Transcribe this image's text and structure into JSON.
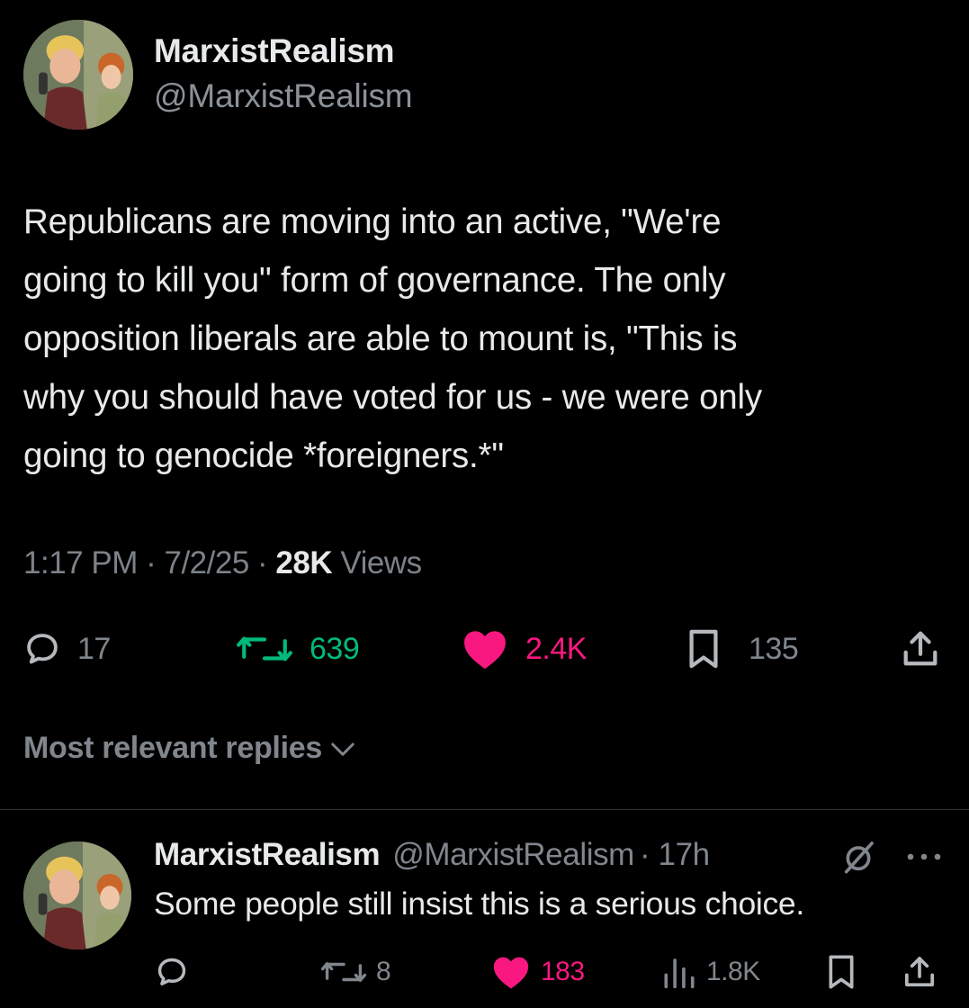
{
  "tweet": {
    "author_name": "MarxistRealism",
    "author_handle": "@MarxistRealism",
    "text": "Republicans are moving into an active, \"We're\ngoing to kill you\" form of governance. The only\nopposition liberals are able to mount is, \"This is\nwhy you should have voted for us - we were only\ngoing to genocide *foreigners.*\"",
    "time": "1:17 PM",
    "separator": "·",
    "date": "7/2/25",
    "views_count": "28K",
    "views_label": "Views",
    "actions": {
      "replies": "17",
      "reposts": "639",
      "likes": "2.4K",
      "bookmarks": "135"
    }
  },
  "replies_sort": {
    "label": "Most relevant replies"
  },
  "reply": {
    "author_name": "MarxistRealism",
    "author_handle": "@MarxistRealism",
    "age": "· 17h",
    "text": "Some people still insist this is a serious choice.",
    "actions": {
      "reposts": "8",
      "likes": "183",
      "views": "1.8K"
    }
  },
  "colors": {
    "background": "#000000",
    "text": "#e7e9ea",
    "muted": "#80868c",
    "repost_active": "#00ba7c",
    "like_active": "#f91880"
  },
  "icons": [
    "avatar-illustration",
    "reply-icon",
    "repost-icon",
    "heart-icon",
    "bookmark-icon",
    "share-icon",
    "chevron-down-icon",
    "grok-icon",
    "more-icon",
    "views-icon"
  ]
}
